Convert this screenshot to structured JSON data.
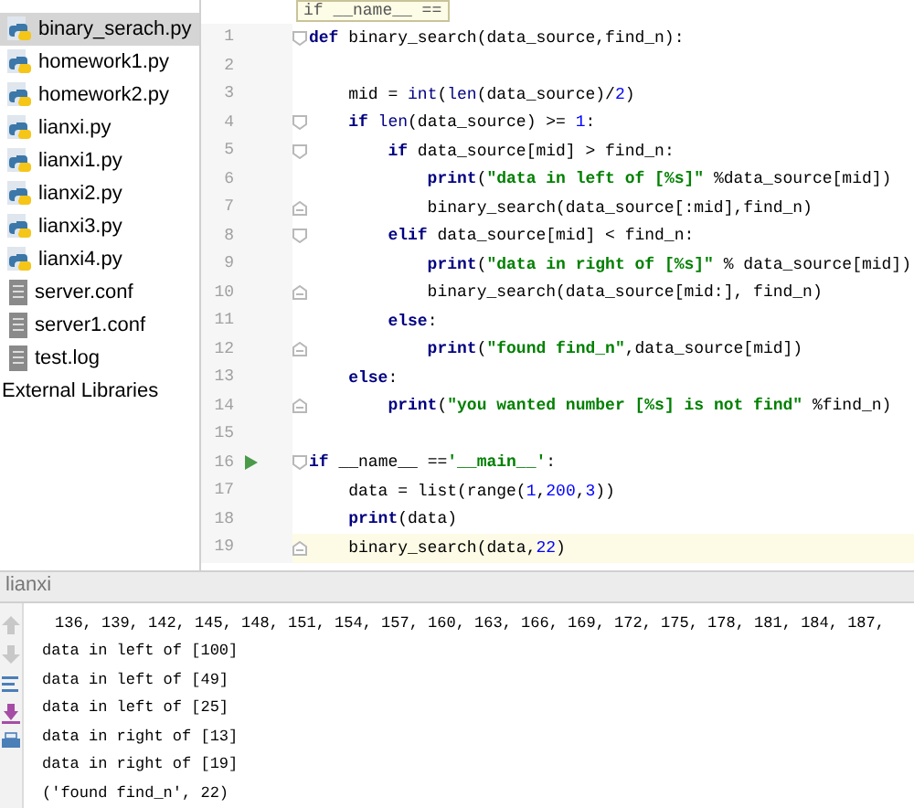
{
  "project_tree": {
    "items": [
      {
        "name": "binary_serach.py",
        "kind": "python",
        "selected": true
      },
      {
        "name": "homework1.py",
        "kind": "python",
        "selected": false
      },
      {
        "name": "homework2.py",
        "kind": "python",
        "selected": false
      },
      {
        "name": "lianxi.py",
        "kind": "python",
        "selected": false
      },
      {
        "name": "lianxi1.py",
        "kind": "python",
        "selected": false
      },
      {
        "name": "lianxi2.py",
        "kind": "python",
        "selected": false
      },
      {
        "name": "lianxi3.py",
        "kind": "python",
        "selected": false
      },
      {
        "name": "lianxi4.py",
        "kind": "python",
        "selected": false
      },
      {
        "name": "server.conf",
        "kind": "text",
        "selected": false
      },
      {
        "name": "server1.conf",
        "kind": "text",
        "selected": false
      },
      {
        "name": "test.log",
        "kind": "text",
        "selected": false
      },
      {
        "name": "External Libraries",
        "kind": "library",
        "selected": false
      }
    ]
  },
  "editor": {
    "tooltip": "if __name__ ==",
    "lines": [
      {
        "number": "1",
        "fold_start": true,
        "tokens": [
          {
            "kind": "keyword",
            "text": "def"
          },
          {
            "kind": "plain",
            "text": " binary_search(data_source,find_n):"
          }
        ]
      },
      {
        "number": "2"
      },
      {
        "number": "3",
        "tokens": [
          {
            "kind": "plain",
            "text": "    mid = "
          },
          {
            "kind": "builtin",
            "text": "int"
          },
          {
            "kind": "plain",
            "text": "("
          },
          {
            "kind": "builtin",
            "text": "len"
          },
          {
            "kind": "plain",
            "text": "(data_source)/"
          },
          {
            "kind": "number",
            "text": "2"
          },
          {
            "kind": "plain",
            "text": ")"
          }
        ]
      },
      {
        "number": "4",
        "fold_start": true,
        "tokens": [
          {
            "kind": "keyword",
            "text": "    if"
          },
          {
            "kind": "builtin",
            "text": " len"
          },
          {
            "kind": "plain",
            "text": "(data_source) >= "
          },
          {
            "kind": "number",
            "text": "1"
          },
          {
            "kind": "plain",
            "text": ":"
          }
        ]
      },
      {
        "number": "5",
        "fold_start": true,
        "tokens": [
          {
            "kind": "keyword",
            "text": "        if"
          },
          {
            "kind": "plain",
            "text": " data_source[mid] > find_n:"
          }
        ]
      },
      {
        "number": "6",
        "tokens": [
          {
            "kind": "keyword",
            "text": "            print"
          },
          {
            "kind": "plain",
            "text": "("
          },
          {
            "kind": "string",
            "text": "\"data in left of [%s]\""
          },
          {
            "kind": "plain",
            "text": " %data_source[mid])"
          }
        ]
      },
      {
        "number": "7",
        "fold_end": true,
        "tokens": [
          {
            "kind": "plain",
            "text": "            binary_search(data_source[:mid],find_n)"
          }
        ]
      },
      {
        "number": "8",
        "fold_start": true,
        "tokens": [
          {
            "kind": "keyword",
            "text": "        elif"
          },
          {
            "kind": "plain",
            "text": " data_source[mid] < find_n:"
          }
        ]
      },
      {
        "number": "9",
        "tokens": [
          {
            "kind": "keyword",
            "text": "            print"
          },
          {
            "kind": "plain",
            "text": "("
          },
          {
            "kind": "string",
            "text": "\"data in right of [%s]\""
          },
          {
            "kind": "plain",
            "text": " % data_source[mid])"
          }
        ]
      },
      {
        "number": "10",
        "fold_end": true,
        "tokens": [
          {
            "kind": "plain",
            "text": "            binary_search(data_source[mid:], find_n)"
          }
        ]
      },
      {
        "number": "11",
        "tokens": [
          {
            "kind": "keyword",
            "text": "        else"
          },
          {
            "kind": "plain",
            "text": ":"
          }
        ]
      },
      {
        "number": "12",
        "fold_end": true,
        "tokens": [
          {
            "kind": "keyword",
            "text": "            print"
          },
          {
            "kind": "plain",
            "text": "("
          },
          {
            "kind": "string",
            "text": "\"found find_n\""
          },
          {
            "kind": "plain",
            "text": ",data_source[mid])"
          }
        ]
      },
      {
        "number": "13",
        "tokens": [
          {
            "kind": "keyword",
            "text": "    else"
          },
          {
            "kind": "plain",
            "text": ":"
          }
        ]
      },
      {
        "number": "14",
        "fold_end": true,
        "tokens": [
          {
            "kind": "keyword",
            "text": "        print"
          },
          {
            "kind": "plain",
            "text": "("
          },
          {
            "kind": "string",
            "text": "\"you wanted number [%s] is not find\""
          },
          {
            "kind": "plain",
            "text": " %find_n)"
          }
        ]
      },
      {
        "number": "15"
      },
      {
        "number": "16",
        "fold_start": true,
        "run": true,
        "tokens": [
          {
            "kind": "keyword",
            "text": "if"
          },
          {
            "kind": "plain",
            "text": " __name__ =="
          },
          {
            "kind": "string",
            "text": "'__main__'"
          },
          {
            "kind": "plain",
            "text": ":"
          }
        ]
      },
      {
        "number": "17",
        "tokens": [
          {
            "kind": "plain",
            "text": "    data = list(range("
          },
          {
            "kind": "number",
            "text": "1"
          },
          {
            "kind": "plain",
            "text": ","
          },
          {
            "kind": "number",
            "text": "200"
          },
          {
            "kind": "plain",
            "text": ","
          },
          {
            "kind": "number",
            "text": "3"
          },
          {
            "kind": "plain",
            "text": "))"
          }
        ]
      },
      {
        "number": "18",
        "tokens": [
          {
            "kind": "keyword",
            "text": "    print"
          },
          {
            "kind": "plain",
            "text": "(data)"
          }
        ]
      },
      {
        "number": "19",
        "fold_end": true,
        "current": true,
        "tokens": [
          {
            "kind": "plain",
            "text": "    binary_search(data,"
          },
          {
            "kind": "number",
            "text": "22"
          },
          {
            "kind": "plain",
            "text": ")"
          }
        ]
      }
    ]
  },
  "run_panel": {
    "title": "lianxi",
    "toolbar": [
      {
        "kind": "up",
        "disabled": true
      },
      {
        "kind": "down",
        "disabled": true
      },
      {
        "kind": "wrap",
        "disabled": false
      },
      {
        "kind": "scroll-end",
        "disabled": false
      },
      {
        "kind": "print",
        "disabled": false
      }
    ],
    "output": [
      "136, 139, 142, 145, 148, 151, 154, 157, 160, 163, 166, 169, 172, 175, 178, 181, 184, 187,",
      "data in left of [100]",
      "data in left of [49]",
      "data in left of [25]",
      "data in right of [13]",
      "data in right of [19]",
      "('found find_n', 22)"
    ]
  }
}
